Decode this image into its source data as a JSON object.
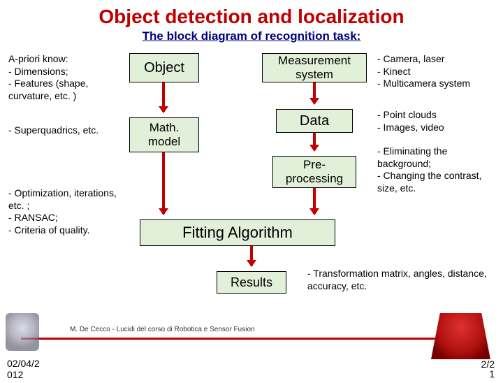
{
  "title": "Object detection and localization",
  "subtitle": "The block diagram of recognition task:",
  "notes": {
    "apriori": "A-priori know:\n - Dimensions;\n - Features (shape, curvature, etc. )",
    "superq": " - Superquadrics, etc.",
    "optim": " - Optimization, iterations, etc. ;\n - RANSAC;\n - Criteria of quality.",
    "meas": " - Camera, laser\n - Kinect\n - Multicamera system",
    "data": " - Point clouds\n - Images, video",
    "preproc": " - Eliminating the background;\n - Changing the contrast, size, etc.",
    "results": " - Transformation matrix, angles, distance, accuracy, etc."
  },
  "boxes": {
    "object": "Object",
    "math": "Math.\nmodel",
    "meas": "Measurement\nsystem",
    "data": "Data",
    "pre": "Pre-\nprocessing",
    "fit": "Fitting Algorithm",
    "results": "Results"
  },
  "footer": {
    "attrib": "M. De Cecco - Lucidi del corso di Robotica e Sensor Fusion",
    "date": "02/04/2",
    "date2": "012",
    "page": "2/2",
    "page2": "1"
  }
}
